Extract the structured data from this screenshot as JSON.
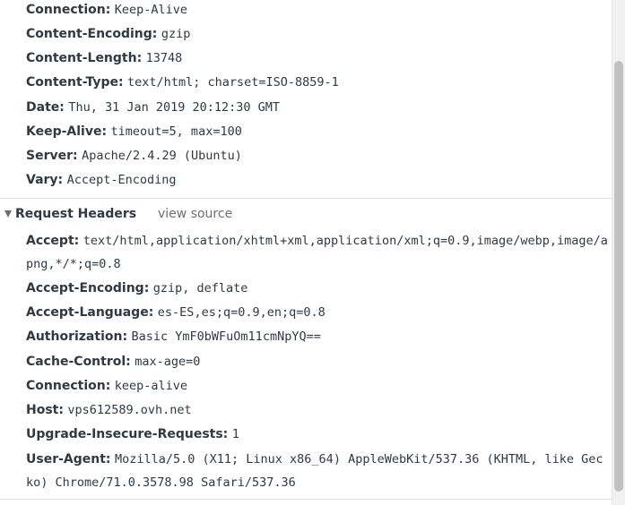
{
  "response_headers": [
    {
      "name": "Connection:",
      "value": "Keep-Alive"
    },
    {
      "name": "Content-Encoding:",
      "value": "gzip"
    },
    {
      "name": "Content-Length:",
      "value": "13748"
    },
    {
      "name": "Content-Type:",
      "value": "text/html; charset=ISO-8859-1"
    },
    {
      "name": "Date:",
      "value": "Thu, 31 Jan 2019 20:12:30 GMT"
    },
    {
      "name": "Keep-Alive:",
      "value": "timeout=5, max=100"
    },
    {
      "name": "Server:",
      "value": "Apache/2.4.29 (Ubuntu)"
    },
    {
      "name": "Vary:",
      "value": "Accept-Encoding"
    }
  ],
  "request_section": {
    "title": "Request Headers",
    "view_source": "view source"
  },
  "request_headers": [
    {
      "name": "Accept:",
      "value": "text/html,application/xhtml+xml,application/xml;q=0.9,image/webp,image/apng,*/*;q=0.8"
    },
    {
      "name": "Accept-Encoding:",
      "value": "gzip, deflate"
    },
    {
      "name": "Accept-Language:",
      "value": "es-ES,es;q=0.9,en;q=0.8"
    },
    {
      "name": "Authorization:",
      "value": "Basic YmF0bWFuOm11cmNpYQ=="
    },
    {
      "name": "Cache-Control:",
      "value": "max-age=0"
    },
    {
      "name": "Connection:",
      "value": "keep-alive"
    },
    {
      "name": "Host:",
      "value": "vps612589.ovh.net"
    },
    {
      "name": "Upgrade-Insecure-Requests:",
      "value": "1"
    },
    {
      "name": "User-Agent:",
      "value": "Mozilla/5.0 (X11; Linux x86_64) AppleWebKit/537.36 (KHTML, like Gecko) Chrome/71.0.3578.98 Safari/537.36"
    }
  ]
}
